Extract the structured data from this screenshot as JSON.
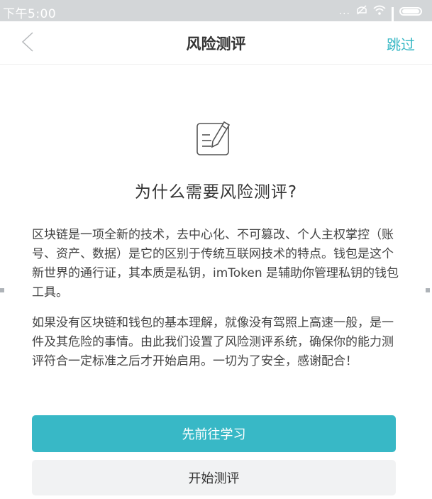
{
  "status_bar": {
    "time": "下午5:00",
    "dots": "...",
    "icons": [
      "mute-icon",
      "wifi-icon",
      "signal-icon",
      "battery-icon"
    ]
  },
  "nav": {
    "back_icon": "chevron-left-icon",
    "title": "风险测评",
    "skip_label": "跳过"
  },
  "content": {
    "icon": "document-edit-icon",
    "heading": "为什么需要风险测评?",
    "paragraph_1": "区块链是一项全新的技术，去中心化、不可篡改、个人主权掌控（账号、资产、数据）是它的区别于传统互联网技术的特点。钱包是这个新世界的通行证，其本质是私钥，imToken 是辅助你管理私钥的钱包工具。",
    "paragraph_2": "如果没有区块链和钱包的基本理解，就像没有驾照上高速一般，是一件及其危险的事情。由此我们设置了风险测评系统，确保你的能力测评符合一定标准之后才开始启用。一切为了安全，感谢配合！"
  },
  "actions": {
    "learn_label": "先前往学习",
    "start_label": "开始测评"
  },
  "colors": {
    "accent": "#35b7c4",
    "primary_button": "#38b8c6",
    "secondary_button": "#f1f2f3",
    "status_bar": "#d3d6d8"
  }
}
